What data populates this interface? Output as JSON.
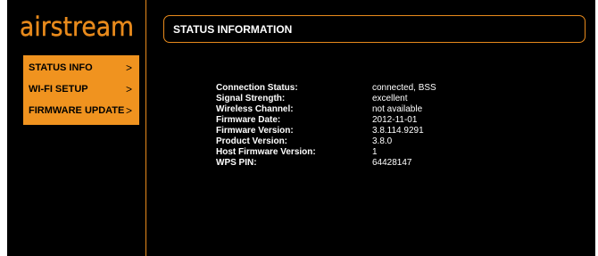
{
  "brand": {
    "logo_text": "airstream",
    "accent_color": "#f0931f",
    "background_color": "#000000"
  },
  "nav": {
    "items": [
      {
        "label": "STATUS INFO",
        "icon": "chevron-right-icon"
      },
      {
        "label": "WI-FI SETUP",
        "icon": "chevron-right-icon"
      },
      {
        "label": "FIRMWARE UPDATE",
        "icon": "chevron-right-icon"
      }
    ],
    "chevron_glyph": ">"
  },
  "header": {
    "title": "STATUS INFORMATION"
  },
  "status": {
    "rows": [
      {
        "label": "Connection Status:",
        "value": "connected, BSS"
      },
      {
        "label": "Signal Strength:",
        "value": "excellent"
      },
      {
        "label": "Wireless Channel:",
        "value": "not available"
      },
      {
        "label": "Firmware Date:",
        "value": "2012-11-01"
      },
      {
        "label": "Firmware Version:",
        "value": "3.8.114.9291"
      },
      {
        "label": "Product Version:",
        "value": "3.8.0"
      },
      {
        "label": "Host Firmware Version:",
        "value": "1"
      },
      {
        "label": "WPS PIN:",
        "value": "64428147"
      }
    ]
  }
}
